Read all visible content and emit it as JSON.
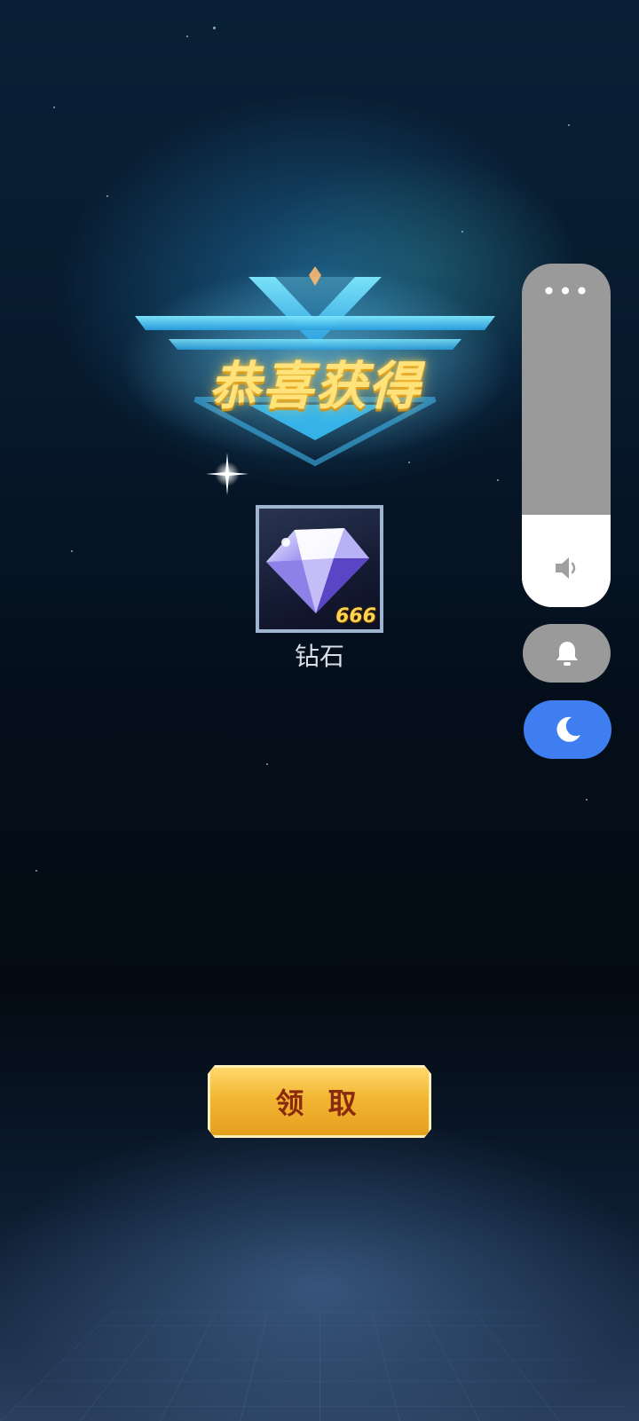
{
  "title": "恭喜获得",
  "reward": {
    "name": "钻石",
    "count": "666",
    "icon": "diamond-icon"
  },
  "claim_button": {
    "label": "领 取"
  },
  "volume_panel": {
    "more_label": "•••",
    "level": 0.27,
    "icons": [
      "speaker-icon",
      "bell-icon",
      "moon-icon"
    ]
  },
  "colors": {
    "title_gold": "#ffe27a",
    "button_gold": "#f2b634",
    "button_text": "#8a2a0c",
    "dnd_blue": "#3f7ef0",
    "panel_gray": "#9a9a9a"
  }
}
